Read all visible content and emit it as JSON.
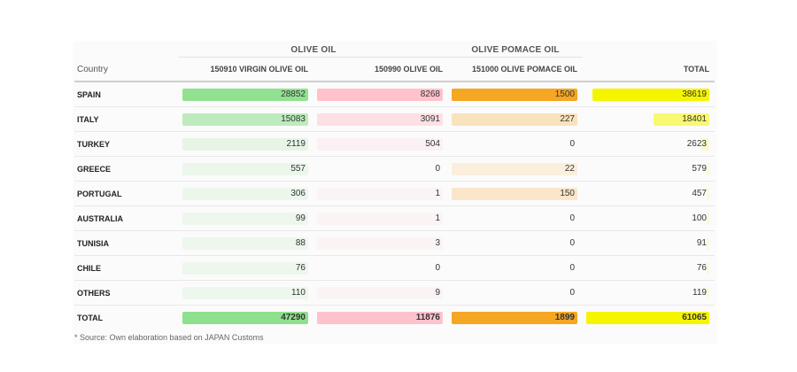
{
  "group_headers": {
    "olive_oil": "OLIVE OIL",
    "olive_pomace_oil": "OLIVE POMACE OIL"
  },
  "columns": {
    "country": "Country",
    "virgin": "150910 VIRGIN OLIVE OIL",
    "other": "150990 OLIVE OIL",
    "pomace": "151000 OLIVE POMACE OIL",
    "total": "TOTAL"
  },
  "rows": [
    {
      "country": "SPAIN",
      "virgin": "28852",
      "other": "8268",
      "pomace": "1500",
      "total": "38619"
    },
    {
      "country": "ITALY",
      "virgin": "15083",
      "other": "3091",
      "pomace": "227",
      "total": "18401"
    },
    {
      "country": "TURKEY",
      "virgin": "2119",
      "other": "504",
      "pomace": "0",
      "total": "2623"
    },
    {
      "country": "GREECE",
      "virgin": "557",
      "other": "0",
      "pomace": "22",
      "total": "579"
    },
    {
      "country": "PORTUGAL",
      "virgin": "306",
      "other": "1",
      "pomace": "150",
      "total": "457"
    },
    {
      "country": "AUSTRALIA",
      "virgin": "99",
      "other": "1",
      "pomace": "0",
      "total": "100"
    },
    {
      "country": "TUNISIA",
      "virgin": "88",
      "other": "3",
      "pomace": "0",
      "total": "91"
    },
    {
      "country": "CHILE",
      "virgin": "76",
      "other": "0",
      "pomace": "0",
      "total": "76"
    },
    {
      "country": "OTHERS",
      "virgin": "110",
      "other": "9",
      "pomace": "0",
      "total": "119"
    }
  ],
  "total_row": {
    "country": "TOTAL",
    "virgin": "47290",
    "other": "11876",
    "pomace": "1899",
    "total": "61065"
  },
  "source_note": "* Source: Own elaboration based on JAPAN Customs",
  "colors": {
    "virgin": "#8ee08e",
    "other": "#ffc2cc",
    "pomace": "#f5a623",
    "total": "#f5f500"
  }
}
